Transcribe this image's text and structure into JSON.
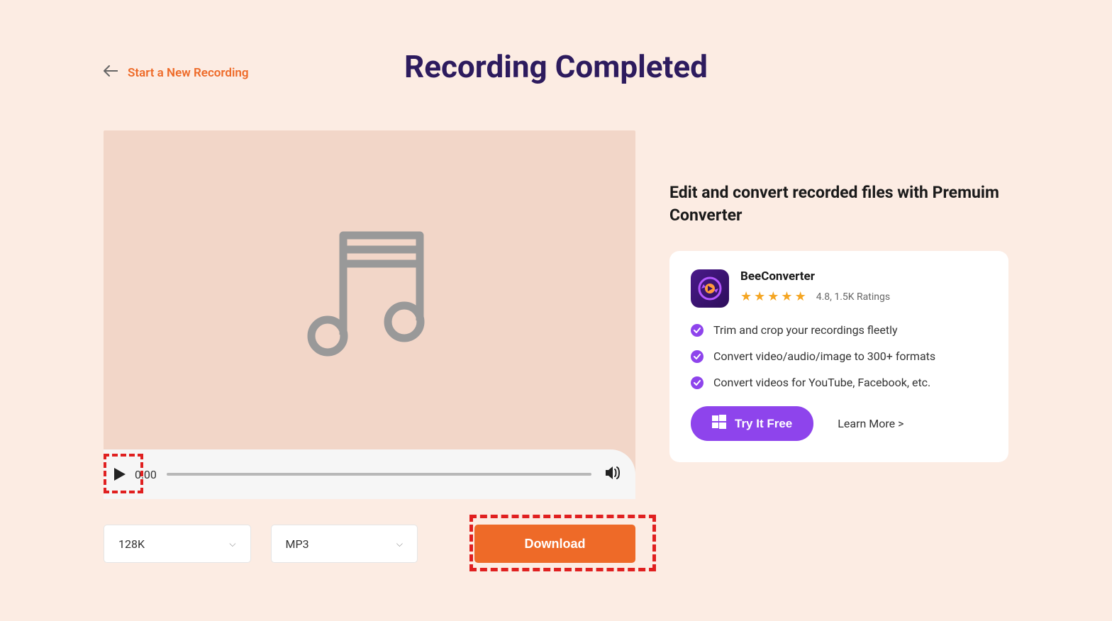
{
  "header": {
    "back_link": "Start a New Recording",
    "title": "Recording Completed"
  },
  "player": {
    "time": "0:00"
  },
  "options": {
    "bitrate": "128K",
    "format": "MP3",
    "download_label": "Download"
  },
  "sidebar": {
    "title": "Edit and convert recorded files with Premuim Converter",
    "promo": {
      "name": "BeeConverter",
      "rating_text": "4.8, 1.5K Ratings",
      "features": [
        "Trim and crop your recordings fleetly",
        "Convert video/audio/image to 300+ formats",
        "Convert videos for YouTube, Facebook, etc."
      ],
      "try_label": "Try It Free",
      "learn_more": "Learn More >"
    }
  }
}
